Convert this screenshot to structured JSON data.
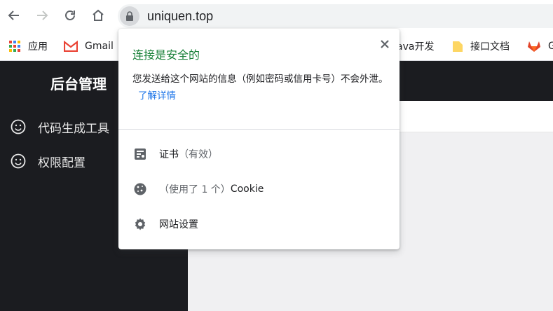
{
  "browser": {
    "url": "uniquen.top"
  },
  "bookmarks": [
    {
      "label": "应用",
      "icon": "apps-grid-icon"
    },
    {
      "label": "Gmail",
      "icon": "gmail-icon"
    },
    {
      "label": "ava开发",
      "icon": "folder-icon"
    },
    {
      "label": "接口文档",
      "icon": "folder-icon"
    },
    {
      "label": "G",
      "icon": "gitlab-icon"
    }
  ],
  "sidebar": {
    "title": "后台管理",
    "items": [
      {
        "label": "代码生成工具",
        "icon": "smile-icon"
      },
      {
        "label": "权限配置",
        "icon": "smile-icon"
      }
    ]
  },
  "popup": {
    "title": "连接是安全的",
    "description": "您发送给这个网站的信息（例如密码或信用卡号）不会外泄。",
    "learn_more": "了解详情",
    "rows": [
      {
        "label": "证书",
        "suffix": "（有效）",
        "icon": "certificate-icon"
      },
      {
        "prefix": "（使用了 1 个）",
        "label": "Cookie",
        "icon": "cookie-icon"
      },
      {
        "label": "网站设置",
        "icon": "gear-icon"
      }
    ]
  },
  "colors": {
    "secure_green": "#188038",
    "link_blue": "#1a73e8",
    "sidebar_bg": "#1b1c20"
  }
}
